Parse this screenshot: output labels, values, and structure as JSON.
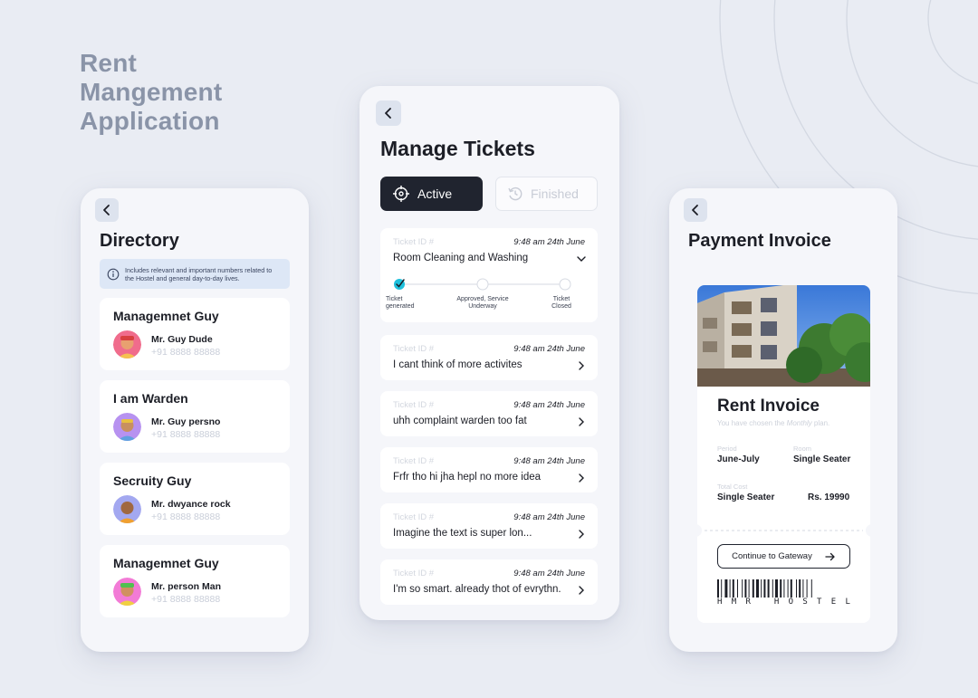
{
  "page": {
    "title_lines": [
      "Rent",
      "Mangement",
      "Application"
    ]
  },
  "colors": {
    "background": "#e9ecf3",
    "accent_dark": "#20242f",
    "step_active": "#1ec0dc",
    "muted_text": "#c9ced9"
  },
  "directory": {
    "back_icon": "chevron-left-icon",
    "title": "Directory",
    "info_icon": "info-icon",
    "info_text": "Includes relevant and important numbers related to the Hostel and general day-to-day lives.",
    "contacts": [
      {
        "role": "Managemnet Guy",
        "name": "Mr. Guy Dude",
        "phone": "+91 8888 88888",
        "avatar_color": "#f06c8c"
      },
      {
        "role": "I am Warden",
        "name": "Mr. Guy persno",
        "phone": "+91 8888 88888",
        "avatar_color": "#b792f0"
      },
      {
        "role": "Secruity Guy",
        "name": "Mr. dwyance rock",
        "phone": "+91 8888 88888",
        "avatar_color": "#a3a8f0"
      },
      {
        "role": "Managemnet Guy",
        "name": "Mr. person Man",
        "phone": "+91 8888 88888",
        "avatar_color": "#f27bd6"
      }
    ]
  },
  "tickets": {
    "back_icon": "chevron-left-icon",
    "title": "Manage Tickets",
    "tab_active": "Active",
    "tab_finished": "Finished",
    "items": [
      {
        "id_label": "Ticket ID #",
        "time": "9:48 am 24th June",
        "title": "Room Cleaning and Washing",
        "expanded": true
      },
      {
        "id_label": "Ticket ID #",
        "time": "9:48 am 24th June",
        "title": "I cant think of more activites",
        "expanded": false
      },
      {
        "id_label": "Ticket ID #",
        "time": "9:48 am 24th June",
        "title": "uhh complaint warden too fat",
        "expanded": false
      },
      {
        "id_label": "Ticket ID #",
        "time": "9:48 am 24th June",
        "title": "Frfr tho hi jha hepl no more idea",
        "expanded": false
      },
      {
        "id_label": "Ticket ID #",
        "time": "9:48 am 24th June",
        "title": "Imagine the text is super lon...",
        "expanded": false
      },
      {
        "id_label": "Ticket ID #",
        "time": "9:48 am 24th June",
        "title": "I'm so smart. already thot of evrythn.",
        "expanded": false
      }
    ],
    "steps": [
      {
        "label_lines": [
          "Ticket",
          "generated"
        ],
        "done": true
      },
      {
        "label_lines": [
          "Approved, Service",
          "Underway"
        ],
        "done": false
      },
      {
        "label_lines": [
          "Ticket",
          "Closed"
        ],
        "done": false
      }
    ]
  },
  "invoice": {
    "back_icon": "chevron-left-icon",
    "title": "Payment Invoice",
    "card_title": "Rent Invoice",
    "subtitle_prefix": "You have chosen the ",
    "subtitle_plan": "Monthly",
    "subtitle_suffix": " plan.",
    "period_label": "Period",
    "period_value": "June-July",
    "room_label": "Room",
    "room_value": "Single Seater",
    "total_label": "Total Cost",
    "total_room": "Single Seater",
    "total_value": "Rs. 19990",
    "button_label": "Continue to Gateway",
    "button_icon": "arrow-right-icon",
    "barcode_text": "HMR HOSTEL"
  }
}
